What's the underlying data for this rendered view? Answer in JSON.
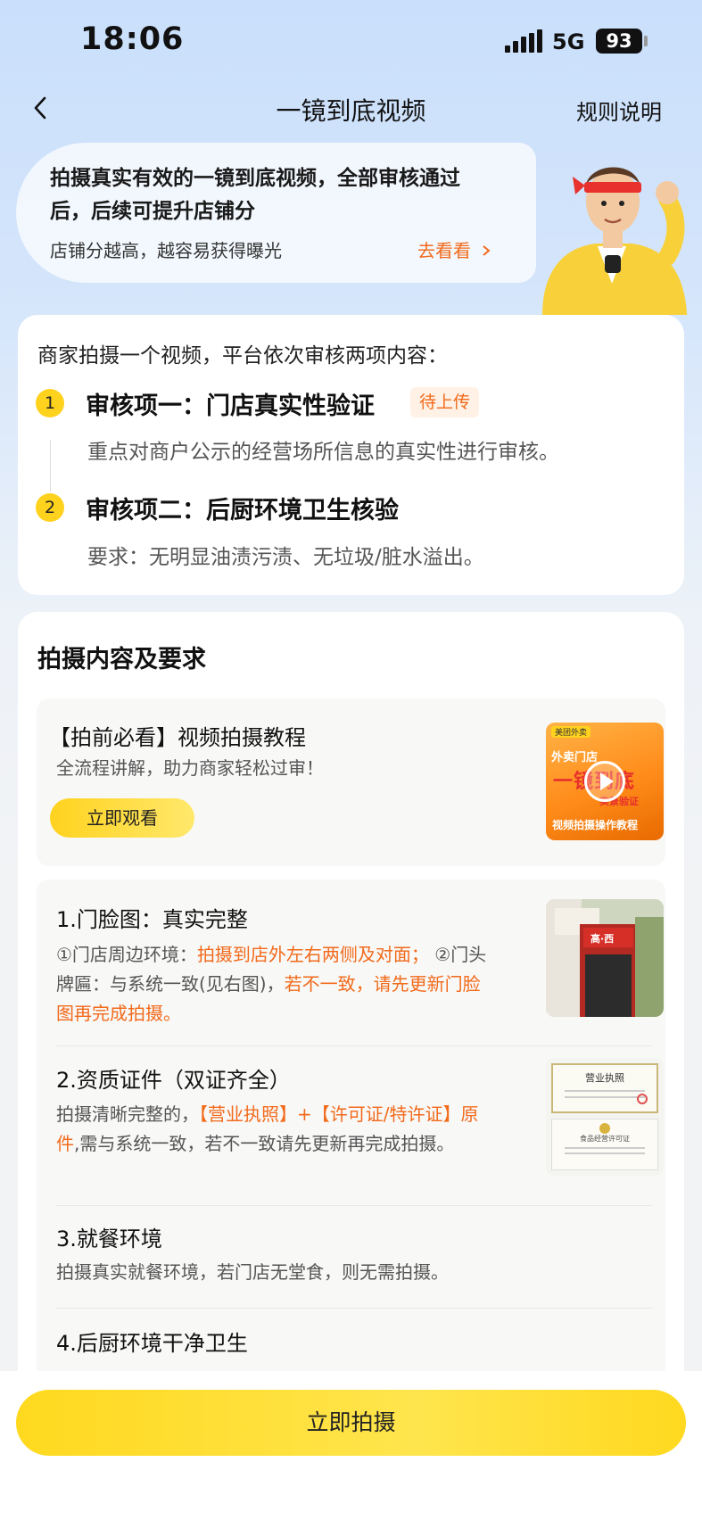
{
  "status_bar": {
    "time": "18:06",
    "network": "5G",
    "battery": "93"
  },
  "nav": {
    "title": "一镜到底视频",
    "rules": "规则说明"
  },
  "banner": {
    "headline": "拍摄真实有效的一镜到底视频，全部审核通过后，后续可提升店铺分",
    "subtext": "店铺分越高，越容易获得曝光",
    "link": "去看看"
  },
  "review": {
    "intro": "商家拍摄一个视频，平台依次审核两项内容：",
    "items": [
      {
        "number": "1",
        "title": "审核项一：门店真实性验证",
        "badge": "待上传",
        "desc": "重点对商户公示的经营场所信息的真实性进行审核。"
      },
      {
        "number": "2",
        "title": "审核项二：后厨环境卫生核验",
        "desc": "要求：无明显油渍污渍、无垃圾/脏水溢出。"
      }
    ]
  },
  "content": {
    "title": "拍摄内容及要求",
    "tutorial": {
      "title": "【拍前必看】视频拍摄教程",
      "subtitle": "全流程讲解，助力商家轻松过审！",
      "button": "立即观看",
      "thumb_tag": "美团外卖",
      "thumb_line1": "外卖门店",
      "thumb_line2": "一镜到底",
      "thumb_line3": "实景验证",
      "thumb_caption": "视频拍摄操作教程"
    },
    "requirements": [
      {
        "title": "1.门脸图：真实完整",
        "p1": "①门店周边环境：",
        "p1_highlight": "拍摄到店外左右两侧及对面；",
        "p2": " ②门头牌匾：与系统一致(见右图)，",
        "p2_highlight": "若不一致，请先更新门脸图再完成拍摄。",
        "sign_text": "高·西"
      },
      {
        "title": "2.资质证件（双证齐全）",
        "p1": "拍摄清晰完整的，",
        "highlight": "【营业执照】+【许可证/特许证】原件",
        "p2": ",需与系统一致，若不一致请先更新再完成拍摄。",
        "cert1": "营业执照",
        "cert2": "食品经营许可证"
      },
      {
        "title": "3.就餐环境",
        "desc": "拍摄真实就餐环境，若门店无堂食，则无需拍摄。"
      },
      {
        "title": "4.后厨环境干净卫生"
      }
    ]
  },
  "bottom": {
    "button": "立即拍摄"
  },
  "colors": {
    "accent_yellow": "#ffd21e",
    "accent_orange": "#f26a1b"
  }
}
